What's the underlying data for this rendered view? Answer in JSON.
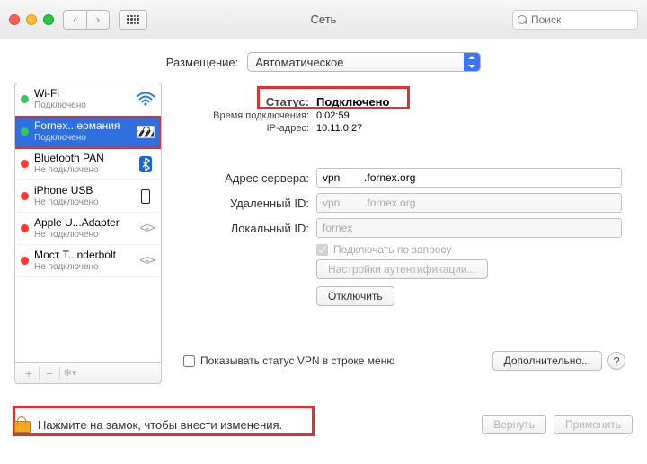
{
  "window": {
    "title": "Сеть",
    "search_placeholder": "Поиск"
  },
  "location": {
    "label": "Размещение:",
    "value": "Автоматическое"
  },
  "sidebar": {
    "items": [
      {
        "name": "Wi-Fi",
        "status": "Подключено",
        "dot": "green",
        "icon": "wifi"
      },
      {
        "name": "Fornex...ермания",
        "status": "Подключено",
        "dot": "green",
        "icon": "vpn",
        "selected": true
      },
      {
        "name": "Bluetooth PAN",
        "status": "Не подключено",
        "dot": "red",
        "icon": "bluetooth"
      },
      {
        "name": "iPhone USB",
        "status": "Не подключено",
        "dot": "red",
        "icon": "phone"
      },
      {
        "name": "Apple U...Adapter",
        "status": "Не подключено",
        "dot": "red",
        "icon": "adapter"
      },
      {
        "name": "Мост T...nderbolt",
        "status": "Не подключено",
        "dot": "red",
        "icon": "thunderbolt"
      }
    ],
    "add": "+",
    "remove": "−",
    "gear": "✻"
  },
  "detail": {
    "status_label": "Статус:",
    "status_value": "Подключено",
    "time_label": "Время подключения:",
    "time_value": "0:02:59",
    "ip_label": "IP-адрес:",
    "ip_value": "10.11.0.27",
    "server_label": "Адрес сервера:",
    "server_value": "vpn        .fornex.org",
    "remote_label": "Удаленный ID:",
    "remote_value": "vpn        .fornex.org",
    "local_label": "Локальный ID:",
    "local_value": "fornex",
    "connect_on_demand": "Подключать по запросу",
    "auth_button": "Настройки аутентификации...",
    "disconnect_button": "Отключить",
    "show_status_label": "Показывать статус VPN в строке меню",
    "advanced_button": "Дополнительно..."
  },
  "footer": {
    "lock_text": "Нажмите на замок, чтобы внести изменения.",
    "revert": "Вернуть",
    "apply": "Применить"
  }
}
